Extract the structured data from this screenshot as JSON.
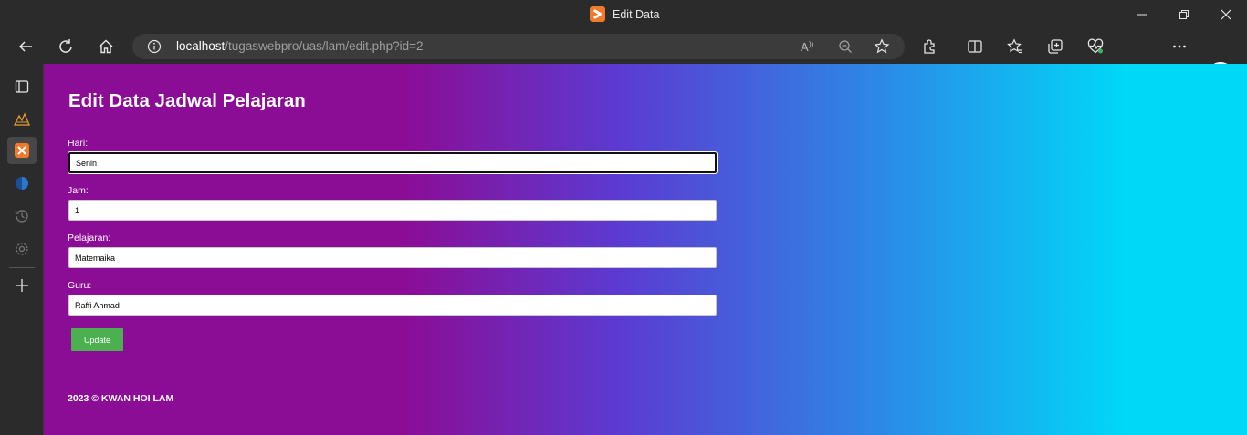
{
  "window": {
    "title": "Edit Data"
  },
  "address_bar": {
    "url_host": "localhost",
    "url_path": "/tugaswebpro/uas/lam/edit.php?id=2"
  },
  "page": {
    "title": "Edit Data Jadwal Pelajaran",
    "fields": [
      {
        "label": "Hari:",
        "value": "Senin"
      },
      {
        "label": "Jam:",
        "value": "1"
      },
      {
        "label": "Pelajaran:",
        "value": "Matemaika"
      },
      {
        "label": "Guru:",
        "value": "Raffi Ahmad"
      }
    ],
    "submit_label": "Update",
    "footer": "2023 © KWAN HOI LAM"
  },
  "icons": {
    "toolbar": [
      "back-icon",
      "refresh-icon",
      "home-icon",
      "info-icon",
      "read-aloud-icon",
      "zoom-out-icon",
      "favorite-star-icon",
      "extensions-icon",
      "split-screen-icon",
      "favorites-icon",
      "collections-icon",
      "health-icon",
      "profile-icon",
      "more-icon",
      "bing-icon"
    ],
    "sidebar": [
      "tab-actions-icon",
      "xampp-triangle-icon",
      "xampp-icon",
      "circle-app-icon",
      "history-icon",
      "settings-icon",
      "add-icon"
    ]
  },
  "colors": {
    "gradient_start": "#8b0d96",
    "gradient_end": "#00d8f8",
    "button_green": "#4caf50",
    "xampp_orange": "#f07a2a",
    "chrome_dark": "#2b2b2b"
  }
}
